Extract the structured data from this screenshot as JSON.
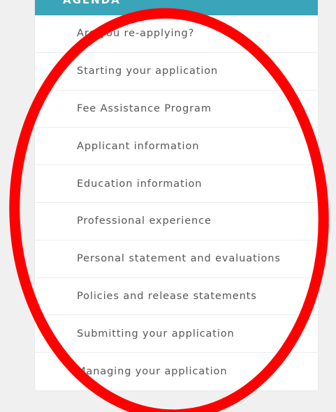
{
  "header": {
    "label": "AGENDA"
  },
  "menu": {
    "items": [
      {
        "label": "Are you re-applying?"
      },
      {
        "label": "Starting your application"
      },
      {
        "label": "Fee Assistance Program"
      },
      {
        "label": "Applicant information"
      },
      {
        "label": "Education information"
      },
      {
        "label": "Professional experience"
      },
      {
        "label": "Personal statement and evaluations"
      },
      {
        "label": "Policies and release statements"
      },
      {
        "label": "Submitting your application"
      },
      {
        "label": "Managing your application"
      }
    ]
  },
  "colors": {
    "header_bg": "#3aa4b8",
    "annotation": "#ff0000",
    "text": "#555555"
  }
}
